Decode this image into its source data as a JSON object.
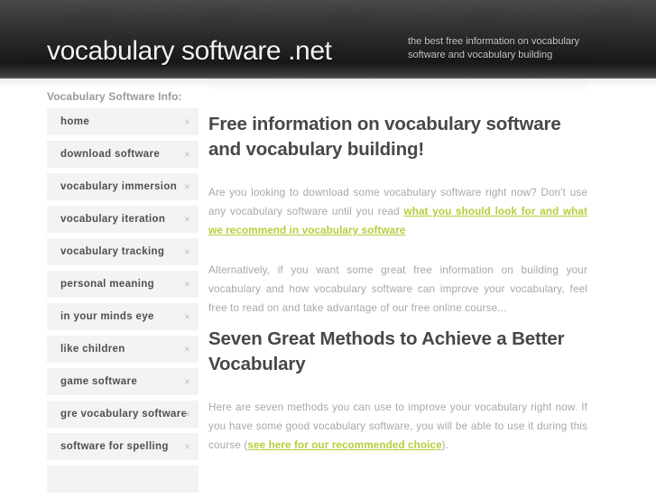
{
  "header": {
    "logo": "vocabulary software .net",
    "tagline": "the best free information on vocabulary software and vocabulary building"
  },
  "sidebar": {
    "title": "Vocabulary Software Info:",
    "close_glyph": "×",
    "items": [
      {
        "label": "home"
      },
      {
        "label": "download software"
      },
      {
        "label": "vocabulary immersion"
      },
      {
        "label": "vocabulary iteration"
      },
      {
        "label": "vocabulary tracking"
      },
      {
        "label": "personal meaning"
      },
      {
        "label": "in your minds eye"
      },
      {
        "label": "like children"
      },
      {
        "label": "game software"
      },
      {
        "label": "gre vocabulary software"
      },
      {
        "label": "software for spelling"
      },
      {
        "label": ""
      }
    ]
  },
  "main": {
    "heading1": "Free information on vocabulary software and vocabulary building!",
    "paragraph1_before": "Are you looking to download some vocabulary software right now? Don't use any vocabulary software until you read ",
    "paragraph1_link": "what you should look for and what we recommend in vocabulary software",
    "paragraph1_after": "",
    "paragraph2": "Alternatively, if you want some great free information on building your vocabulary and how vocabulary software can improve your vocabulary, feel free to read on and take advantage of our free online course...",
    "heading2": "Seven Great Methods to Achieve a Better Vocabulary",
    "paragraph3_before": "Here are seven methods you can use to improve your vocabulary right now. If you have some good vocabulary software, you will be able to use it during this course (",
    "paragraph3_link": "see here for our recommended choice",
    "paragraph3_after": ")."
  },
  "colors": {
    "link": "#b9cc3b",
    "heading": "#474747",
    "body_text": "#a8a8a8",
    "sidebar_item_bg": "#f3f3f3",
    "header_dark": "#232323"
  }
}
